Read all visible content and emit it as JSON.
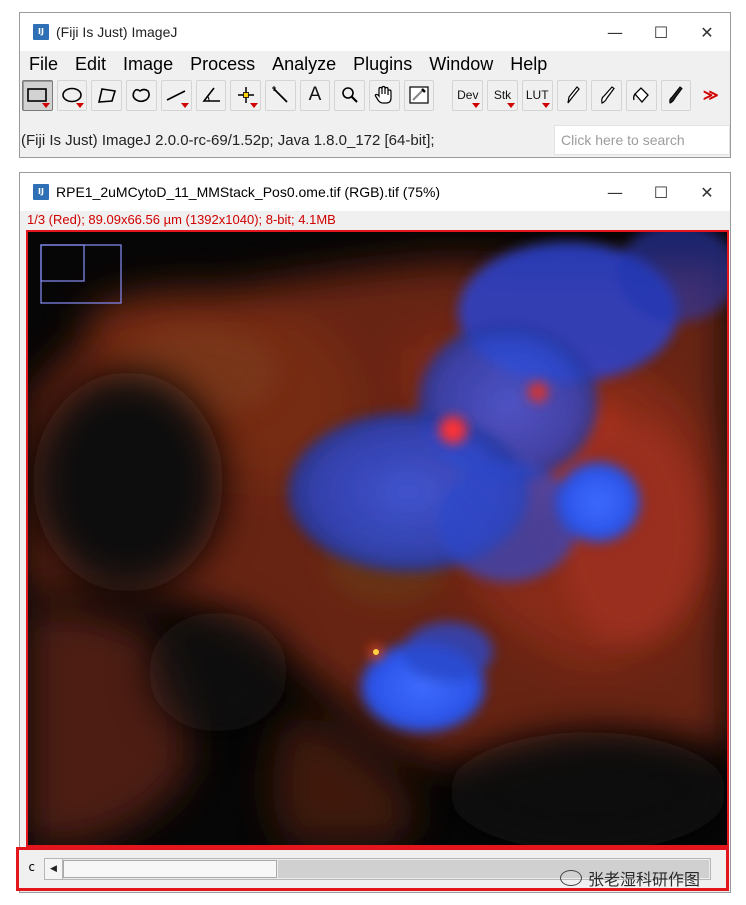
{
  "main_window": {
    "title": "(Fiji Is Just) ImageJ",
    "icon": "fiji-app-icon",
    "controls": {
      "minimize": "—",
      "maximize": "☐",
      "close": "✕"
    },
    "menu": [
      "File",
      "Edit",
      "Image",
      "Process",
      "Analyze",
      "Plugins",
      "Window",
      "Help"
    ],
    "tools": [
      {
        "name": "rectangle-tool",
        "icon": "rectangle-icon"
      },
      {
        "name": "oval-tool",
        "icon": "oval-icon"
      },
      {
        "name": "polygon-tool",
        "icon": "polygon-icon"
      },
      {
        "name": "freehand-tool",
        "icon": "freehand-icon"
      },
      {
        "name": "line-tool",
        "icon": "line-icon"
      },
      {
        "name": "angle-tool",
        "icon": "angle-icon"
      },
      {
        "name": "point-tool",
        "icon": "point-icon"
      },
      {
        "name": "wand-tool",
        "icon": "wand-icon"
      },
      {
        "name": "text-tool",
        "label": "A"
      },
      {
        "name": "zoom-tool",
        "icon": "magnifier-icon"
      },
      {
        "name": "hand-tool",
        "icon": "hand-icon"
      },
      {
        "name": "dropper-tool",
        "icon": "dropper-icon"
      },
      {
        "name": "dev-menu",
        "label": "Dev"
      },
      {
        "name": "stk-menu",
        "label": "Stk"
      },
      {
        "name": "lut-menu",
        "label": "LUT"
      },
      {
        "name": "pencil-tool",
        "icon": "pencil-icon"
      },
      {
        "name": "brush-tool",
        "icon": "brush-icon"
      },
      {
        "name": "flood-fill-tool",
        "icon": "flood-fill-icon"
      },
      {
        "name": "paintbrush-tool",
        "icon": "paintbrush-icon"
      },
      {
        "name": "more-tools",
        "label": "≫"
      }
    ],
    "status": "(Fiji Is Just) ImageJ 2.0.0-rc-69/1.52p; Java 1.8.0_172 [64-bit];",
    "search_placeholder": "Click here to search"
  },
  "image_window": {
    "title": "RPE1_2uMCytoD_11_MMStack_Pos0.ome.tif (RGB).tif (75%)",
    "info": "1/3 (Red); 89.09x66.56 µm (1392x1040); 8-bit; 4.1MB",
    "channel_label": "c",
    "channel_position": 0.25,
    "watermark": "张老湿科研作图"
  },
  "colors": {
    "highlight": "#e4161d",
    "info_text": "#d00000",
    "nucleus_blue": "#2a56e8",
    "cytoplasm_red": "#c0321e"
  }
}
